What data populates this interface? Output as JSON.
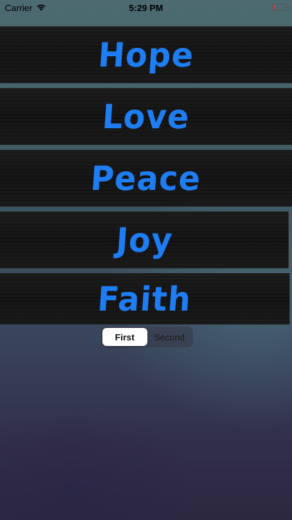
{
  "status_bar": {
    "carrier": "Carrier",
    "time": "5:29 PM",
    "battery_level": 0.12,
    "battery_color": "#e0303a",
    "wifi_icon": "wifi-icon",
    "battery_icon": "battery-icon"
  },
  "words": [
    {
      "label": "Hope"
    },
    {
      "label": "Love"
    },
    {
      "label": "Peace"
    },
    {
      "label": "Joy"
    },
    {
      "label": "Faith"
    }
  ],
  "word_color": "#1e7df2",
  "segmented_control": {
    "options": [
      "First",
      "Second"
    ],
    "selected": "First"
  }
}
